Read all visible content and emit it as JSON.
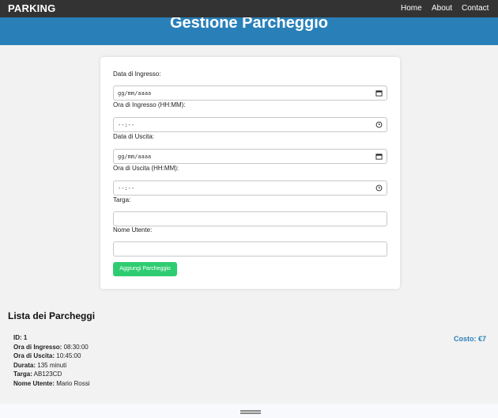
{
  "nav": {
    "brand": "PARKING",
    "links": [
      "Home",
      "About",
      "Contact"
    ]
  },
  "banner": {
    "title": "Gestione Parcheggio"
  },
  "form": {
    "entry_date_label": "Data di Ingresso:",
    "entry_date_placeholder": "gg/mm/aaaa",
    "entry_time_label": "Ora di Ingresso (HH:MM):",
    "entry_time_placeholder": "--:--",
    "exit_date_label": "Data di Uscita:",
    "exit_date_placeholder": "gg/mm/aaaa",
    "exit_time_label": "Ora di Uscita (HH:MM):",
    "exit_time_placeholder": "--:--",
    "plate_label": "Targa:",
    "plate_value": "",
    "user_label": "Nome Utente:",
    "user_value": "",
    "submit_label": "Aggiungi Parcheggio"
  },
  "list": {
    "title": "Lista dei Parcheggi",
    "entries": [
      {
        "id_label": "ID:",
        "id": "1",
        "entry_time_label": "Ora di Ingresso:",
        "entry_time": "08:30:00",
        "exit_time_label": "Ora di Uscita:",
        "exit_time": "10:45:00",
        "duration_label": "Durata:",
        "duration": "135 minuti",
        "plate_label": "Targa:",
        "plate": "AB123CD",
        "user_label": "Nome Utente:",
        "user": "Mario Rossi",
        "cost_label": "Costo: €7"
      }
    ]
  },
  "colors": {
    "nav_bg": "#333333",
    "banner_bg": "#2980b9",
    "button_bg": "#2ecc71",
    "cost_text": "#2980b9"
  }
}
